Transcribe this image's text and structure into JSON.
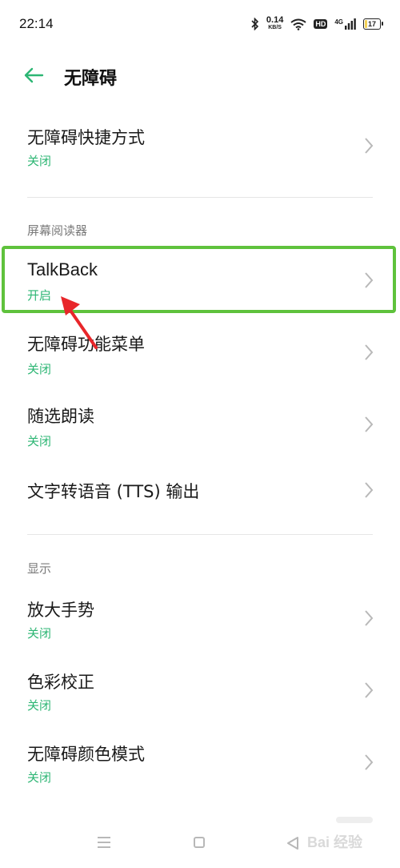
{
  "status": {
    "time": "22:14",
    "net_speed_value": "0.14",
    "net_speed_unit": "KB/S",
    "hd": "HD",
    "network": "4G",
    "battery": "17",
    "battery_level": 0.17
  },
  "header": {
    "title": "无障碍"
  },
  "rows": [
    {
      "label": "无障碍快捷方式",
      "sub": "关闭"
    },
    {
      "label": "TalkBack",
      "sub": "开启"
    },
    {
      "label": "无障碍功能菜单",
      "sub": "关闭"
    },
    {
      "label": "随选朗读",
      "sub": "关闭"
    },
    {
      "label": "文字转语音 (TTS) 输出",
      "sub": ""
    },
    {
      "label": "放大手势",
      "sub": "关闭"
    },
    {
      "label": "色彩校正",
      "sub": "关闭"
    },
    {
      "label": "无障碍颜色模式",
      "sub": "关闭"
    }
  ],
  "sections": {
    "screen_reader": "屏幕阅读器",
    "display": "显示"
  },
  "watermark": "Bai 经验",
  "colors": {
    "accent": "#2db674",
    "highlight": "#5fc23c",
    "arrow": "#e8262a"
  }
}
